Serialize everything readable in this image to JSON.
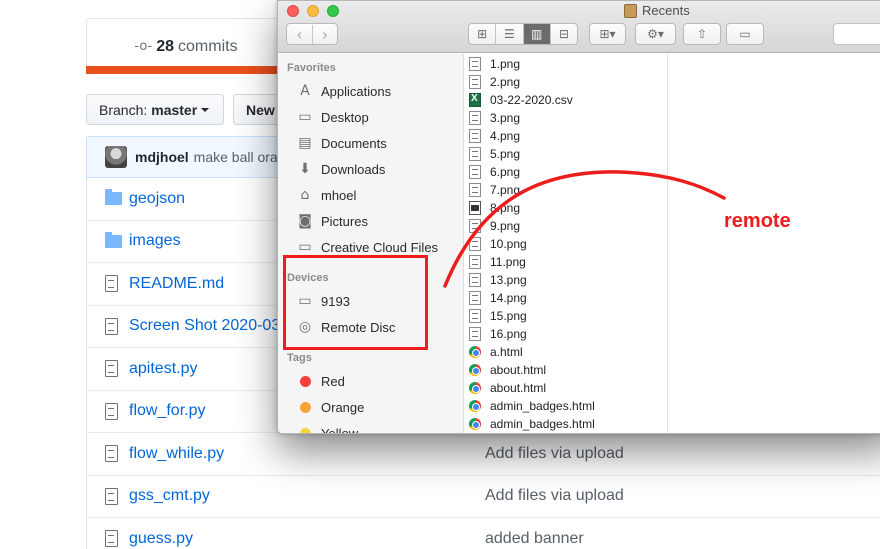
{
  "github": {
    "commits_count": "28",
    "commits_label": "commits",
    "branch_label": "Branch:",
    "branch_value": "master",
    "new_button": "New",
    "last_commit": {
      "author": "mdjhoel",
      "message": "make ball ora"
    },
    "files": [
      {
        "type": "folder",
        "name": "geojson",
        "message": ""
      },
      {
        "type": "folder",
        "name": "images",
        "message": ""
      },
      {
        "type": "file",
        "name": "README.md",
        "message": ""
      },
      {
        "type": "file",
        "name": "Screen Shot 2020-03",
        "message": ""
      },
      {
        "type": "file",
        "name": "apitest.py",
        "message": ""
      },
      {
        "type": "file",
        "name": "flow_for.py",
        "message": ""
      },
      {
        "type": "file",
        "name": "flow_while.py",
        "message": "Add files via upload"
      },
      {
        "type": "file",
        "name": "gss_cmt.py",
        "message": "Add files via upload"
      },
      {
        "type": "file",
        "name": "guess.py",
        "message": "added banner"
      }
    ]
  },
  "finder": {
    "title": "Recents",
    "sidebar": {
      "favorites_header": "Favorites",
      "favorites": [
        {
          "label": "Applications",
          "icon": "applications-icon"
        },
        {
          "label": "Desktop",
          "icon": "desktop-icon"
        },
        {
          "label": "Documents",
          "icon": "documents-icon"
        },
        {
          "label": "Downloads",
          "icon": "downloads-icon"
        },
        {
          "label": "mhoel",
          "icon": "home-icon"
        },
        {
          "label": "Pictures",
          "icon": "pictures-icon"
        },
        {
          "label": "Creative Cloud Files",
          "icon": "folder-icon"
        }
      ],
      "devices_header": "Devices",
      "devices": [
        {
          "label": "9193",
          "icon": "laptop-icon"
        },
        {
          "label": "Remote Disc",
          "icon": "disc-icon"
        }
      ],
      "tags_header": "Tags",
      "tags": [
        {
          "label": "Red",
          "color": "#f5413d"
        },
        {
          "label": "Orange",
          "color": "#f9a33a"
        },
        {
          "label": "Yellow",
          "color": "#f7d33a"
        }
      ]
    },
    "files": [
      {
        "name": "1.png",
        "kind": "png"
      },
      {
        "name": "2.png",
        "kind": "png"
      },
      {
        "name": "03-22-2020.csv",
        "kind": "csv"
      },
      {
        "name": "3.png",
        "kind": "png"
      },
      {
        "name": "4.png",
        "kind": "png"
      },
      {
        "name": "5.png",
        "kind": "png"
      },
      {
        "name": "6.png",
        "kind": "png"
      },
      {
        "name": "7.png",
        "kind": "png"
      },
      {
        "name": "8.png",
        "kind": "png-dark"
      },
      {
        "name": "9.png",
        "kind": "png"
      },
      {
        "name": "10.png",
        "kind": "png"
      },
      {
        "name": "11.png",
        "kind": "png"
      },
      {
        "name": "13.png",
        "kind": "png"
      },
      {
        "name": "14.png",
        "kind": "png"
      },
      {
        "name": "15.png",
        "kind": "png"
      },
      {
        "name": "16.png",
        "kind": "png"
      },
      {
        "name": "a.html",
        "kind": "html"
      },
      {
        "name": "about.html",
        "kind": "html"
      },
      {
        "name": "about.html",
        "kind": "html"
      },
      {
        "name": "admin_badges.html",
        "kind": "html"
      },
      {
        "name": "admin_badges.html",
        "kind": "html"
      }
    ]
  },
  "annotation": {
    "label": "remote",
    "color": "#ee1c1c"
  }
}
